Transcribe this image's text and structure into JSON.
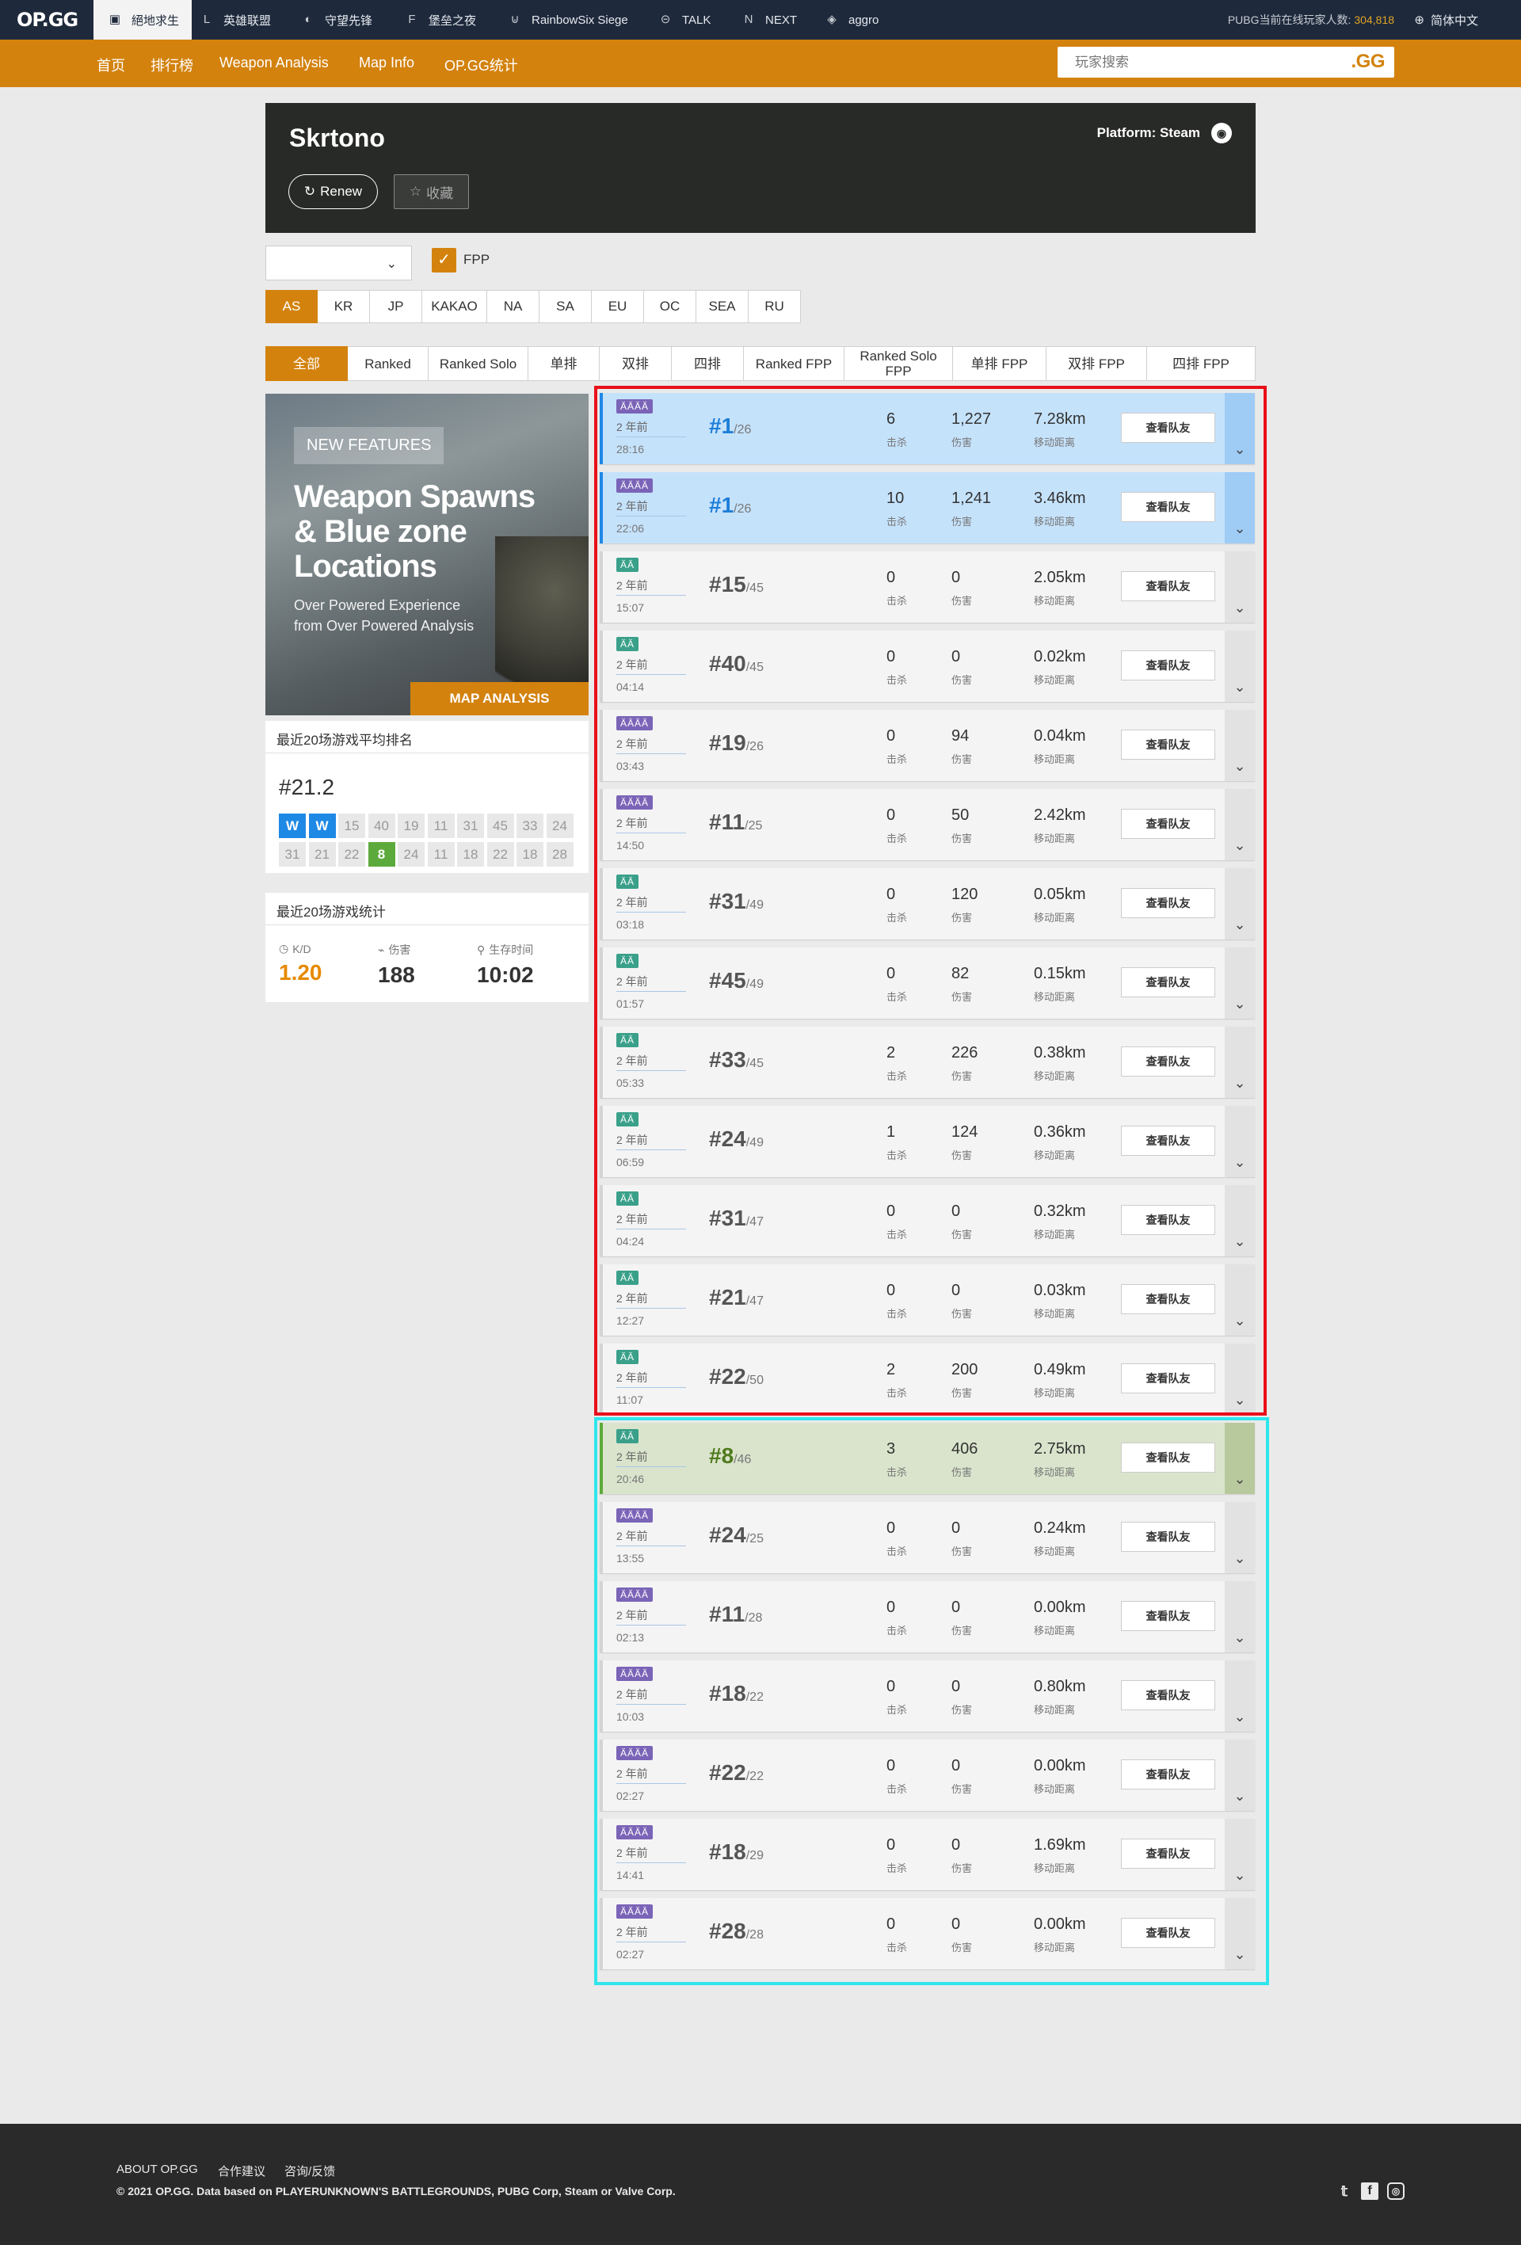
{
  "topbar": {
    "logo": "OP.GG",
    "games": [
      {
        "label": "絕地求生",
        "icon": "pubg-icon"
      },
      {
        "label": "英雄联盟",
        "icon": "lol-icon"
      },
      {
        "label": "守望先锋",
        "icon": "overwatch-icon"
      },
      {
        "label": "堡垒之夜",
        "icon": "fortnite-icon"
      },
      {
        "label": "RainbowSix Siege",
        "icon": "r6-icon"
      },
      {
        "label": "TALK",
        "icon": "talk-icon"
      },
      {
        "label": "NEXT",
        "icon": "next-icon"
      },
      {
        "label": "aggro",
        "icon": "aggro-icon"
      }
    ],
    "online_label": "PUBG当前在线玩家人数:",
    "online_count": "304,818",
    "language": "简体中文"
  },
  "nav": {
    "items": [
      "首页",
      "排行榜",
      "Weapon Analysis",
      "Map Info",
      "OP.GG统计"
    ],
    "search_placeholder": "玩家搜索",
    "search_button": ".GG"
  },
  "profile": {
    "name": "Skrtono",
    "renew_label": "Renew",
    "favorite_label": "收藏",
    "platform": "Platform: Steam"
  },
  "filters": {
    "season_value": "",
    "fpp_label": "FPP",
    "fpp_checked": true,
    "regions": [
      "AS",
      "KR",
      "JP",
      "KAKAO",
      "NA",
      "SA",
      "EU",
      "OC",
      "SEA",
      "RU"
    ],
    "active_region": "AS",
    "modes": [
      "全部",
      "Ranked",
      "Ranked Solo",
      "单排",
      "双排",
      "四排",
      "Ranked FPP",
      "Ranked Solo FPP",
      "单排 FPP",
      "双排 FPP",
      "四排 FPP"
    ],
    "active_mode": "全部"
  },
  "banner": {
    "tag": "NEW FEATURES",
    "headline_1": "Weapon Spawns",
    "headline_2": "& Blue zone",
    "headline_3": "Locations",
    "sub_1": "Over Powered Experience",
    "sub_2": "from Over Powered Analysis",
    "button": "MAP ANALYSIS"
  },
  "avg_rank": {
    "title": "最近20场游戏平均排名",
    "value": "#21.2",
    "ranks": [
      "W",
      "W",
      "15",
      "40",
      "19",
      "11",
      "31",
      "45",
      "33",
      "24",
      "31",
      "21",
      "22",
      "8",
      "24",
      "11",
      "18",
      "22",
      "18",
      "28"
    ]
  },
  "recent_stats": {
    "title": "最近20场游戏统计",
    "kd_label": "K/D",
    "kd": "1.20",
    "damage_label": "伤害",
    "damage": "188",
    "survival_label": "生存时间",
    "survival": "10:02"
  },
  "labels": {
    "kills": "击杀",
    "damage": "伤害",
    "distance": "移动距离",
    "team_button": "查看队友"
  },
  "matches": [
    {
      "mode": "squad",
      "badge": "ÄÄÄÄ",
      "ago": "2 年前",
      "duration": "28:16",
      "rank": "#1",
      "total": "/26",
      "kills": "6",
      "damage": "1,227",
      "distance": "7.28km",
      "result": "win"
    },
    {
      "mode": "squad",
      "badge": "ÄÄÄÄ",
      "ago": "2 年前",
      "duration": "22:06",
      "rank": "#1",
      "total": "/26",
      "kills": "10",
      "damage": "1,241",
      "distance": "3.46km",
      "result": "win"
    },
    {
      "mode": "solo",
      "badge": "ÄÄ",
      "ago": "2 年前",
      "duration": "15:07",
      "rank": "#15",
      "total": "/45",
      "kills": "0",
      "damage": "0",
      "distance": "2.05km",
      "result": "normal"
    },
    {
      "mode": "solo",
      "badge": "ÄÄ",
      "ago": "2 年前",
      "duration": "04:14",
      "rank": "#40",
      "total": "/45",
      "kills": "0",
      "damage": "0",
      "distance": "0.02km",
      "result": "normal"
    },
    {
      "mode": "squad",
      "badge": "ÄÄÄÄ",
      "ago": "2 年前",
      "duration": "03:43",
      "rank": "#19",
      "total": "/26",
      "kills": "0",
      "damage": "94",
      "distance": "0.04km",
      "result": "normal"
    },
    {
      "mode": "squad",
      "badge": "ÄÄÄÄ",
      "ago": "2 年前",
      "duration": "14:50",
      "rank": "#11",
      "total": "/25",
      "kills": "0",
      "damage": "50",
      "distance": "2.42km",
      "result": "normal"
    },
    {
      "mode": "solo",
      "badge": "ÄÄ",
      "ago": "2 年前",
      "duration": "03:18",
      "rank": "#31",
      "total": "/49",
      "kills": "0",
      "damage": "120",
      "distance": "0.05km",
      "result": "normal"
    },
    {
      "mode": "solo",
      "badge": "ÄÄ",
      "ago": "2 年前",
      "duration": "01:57",
      "rank": "#45",
      "total": "/49",
      "kills": "0",
      "damage": "82",
      "distance": "0.15km",
      "result": "normal"
    },
    {
      "mode": "solo",
      "badge": "ÄÄ",
      "ago": "2 年前",
      "duration": "05:33",
      "rank": "#33",
      "total": "/45",
      "kills": "2",
      "damage": "226",
      "distance": "0.38km",
      "result": "normal"
    },
    {
      "mode": "solo",
      "badge": "ÄÄ",
      "ago": "2 年前",
      "duration": "06:59",
      "rank": "#24",
      "total": "/49",
      "kills": "1",
      "damage": "124",
      "distance": "0.36km",
      "result": "normal"
    },
    {
      "mode": "solo",
      "badge": "ÄÄ",
      "ago": "2 年前",
      "duration": "04:24",
      "rank": "#31",
      "total": "/47",
      "kills": "0",
      "damage": "0",
      "distance": "0.32km",
      "result": "normal"
    },
    {
      "mode": "solo",
      "badge": "ÄÄ",
      "ago": "2 年前",
      "duration": "12:27",
      "rank": "#21",
      "total": "/47",
      "kills": "0",
      "damage": "0",
      "distance": "0.03km",
      "result": "normal"
    },
    {
      "mode": "solo",
      "badge": "ÄÄ",
      "ago": "2 年前",
      "duration": "11:07",
      "rank": "#22",
      "total": "/50",
      "kills": "2",
      "damage": "200",
      "distance": "0.49km",
      "result": "normal"
    },
    {
      "mode": "solo",
      "badge": "ÄÄ",
      "ago": "2 年前",
      "duration": "20:46",
      "rank": "#8",
      "total": "/46",
      "kills": "3",
      "damage": "406",
      "distance": "2.75km",
      "result": "top10"
    },
    {
      "mode": "squad",
      "badge": "ÄÄÄÄ",
      "ago": "2 年前",
      "duration": "13:55",
      "rank": "#24",
      "total": "/25",
      "kills": "0",
      "damage": "0",
      "distance": "0.24km",
      "result": "normal"
    },
    {
      "mode": "squad",
      "badge": "ÄÄÄÄ",
      "ago": "2 年前",
      "duration": "02:13",
      "rank": "#11",
      "total": "/28",
      "kills": "0",
      "damage": "0",
      "distance": "0.00km",
      "result": "normal"
    },
    {
      "mode": "squad",
      "badge": "ÄÄÄÄ",
      "ago": "2 年前",
      "duration": "10:03",
      "rank": "#18",
      "total": "/22",
      "kills": "0",
      "damage": "0",
      "distance": "0.80km",
      "result": "normal"
    },
    {
      "mode": "squad",
      "badge": "ÄÄÄÄ",
      "ago": "2 年前",
      "duration": "02:27",
      "rank": "#22",
      "total": "/22",
      "kills": "0",
      "damage": "0",
      "distance": "0.00km",
      "result": "normal"
    },
    {
      "mode": "squad",
      "badge": "ÄÄÄÄ",
      "ago": "2 年前",
      "duration": "14:41",
      "rank": "#18",
      "total": "/29",
      "kills": "0",
      "damage": "0",
      "distance": "1.69km",
      "result": "normal"
    },
    {
      "mode": "squad",
      "badge": "ÄÄÄÄ",
      "ago": "2 年前",
      "duration": "02:27",
      "rank": "#28",
      "total": "/28",
      "kills": "0",
      "damage": "0",
      "distance": "0.00km",
      "result": "normal"
    }
  ],
  "footer": {
    "links": [
      "ABOUT OP.GG",
      "合作建议",
      "咨询/反馈"
    ],
    "copyright": "© 2021 OP.GG. Data based on PLAYERUNKNOWN'S BATTLEGROUNDS, PUBG Corp, Steam or Valve Corp.",
    "social": [
      "twitter-icon",
      "facebook-icon",
      "instagram-icon"
    ]
  },
  "colors": {
    "brand_orange": "#d3820e",
    "topbar": "#1e2a3c",
    "win_blue": "#1e88e5",
    "top10_green": "#5caa3c",
    "highlight_red": "#e8101a",
    "highlight_cyan": "#2ee6ec"
  }
}
